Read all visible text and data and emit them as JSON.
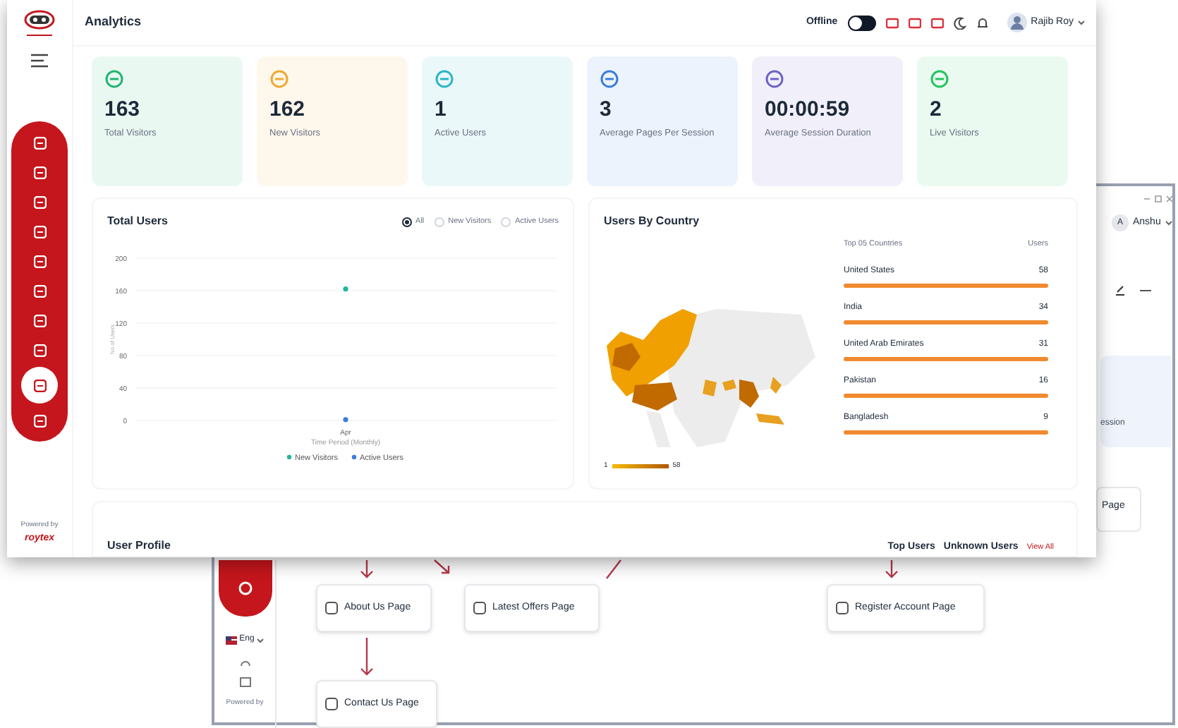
{
  "back_window": {
    "avatar_letter": "A",
    "user_name": "Anshu",
    "card_text": "ession",
    "node_partial": "Page",
    "sidebar": {
      "language": "Eng",
      "powered_by": "Powered by"
    },
    "flow_nodes": [
      {
        "label": "About Us Page"
      },
      {
        "label": "Latest Offers Page"
      },
      {
        "label": "Register Account Page"
      },
      {
        "label": "Contact Us Page"
      }
    ]
  },
  "front_window": {
    "sidebar": {
      "nav_items": [
        {
          "selected": false
        },
        {
          "selected": false
        },
        {
          "selected": false
        },
        {
          "selected": false
        },
        {
          "selected": false
        },
        {
          "selected": false
        },
        {
          "selected": false
        },
        {
          "selected": false
        },
        {
          "selected": true
        },
        {
          "selected": false
        }
      ],
      "powered_by": "Powered by",
      "brand": "roytex"
    },
    "header": {
      "title": "Analytics",
      "status_label": "Offline",
      "status_on": false,
      "user_name": "Rajib Roy"
    },
    "stats": [
      {
        "value": "163",
        "label": "Total Visitors",
        "color": "#22b573"
      },
      {
        "value": "162",
        "label": "New Visitors",
        "color": "#f0a830"
      },
      {
        "value": "1",
        "label": "Active Users",
        "color": "#2bb5c8"
      },
      {
        "value": "3",
        "label": "Average Pages Per Session",
        "color": "#3b7ddd"
      },
      {
        "value": "00:00:59",
        "label": "Average Session Duration",
        "color": "#6c63c9"
      },
      {
        "value": "2",
        "label": "Live Visitors",
        "color": "#22c55e"
      }
    ],
    "total_users": {
      "title": "Total Users",
      "filters": [
        {
          "label": "All",
          "selected": true
        },
        {
          "label": "New Visitors",
          "selected": false
        },
        {
          "label": "Active Users",
          "selected": false
        }
      ],
      "chart_data": {
        "type": "scatter",
        "grid": true,
        "legend": "bottom",
        "xlabel": "Time Period (Monthly)",
        "ylabel": "No of Users",
        "categories": [
          "Apr"
        ],
        "yticks": [
          200,
          160,
          120,
          80,
          40,
          0
        ],
        "ylim": [
          0,
          200
        ],
        "series": [
          {
            "name": "New Visitors",
            "color": "#22b5a0",
            "values": [
              162
            ]
          },
          {
            "name": "Active Users",
            "color": "#3b7ddd",
            "values": [
              1
            ]
          }
        ]
      }
    },
    "users_by_country": {
      "title": "Users By Country",
      "map_legend": {
        "min": "1",
        "max": "58"
      },
      "columns": [
        "Top 05 Countries",
        "Users"
      ],
      "rows": [
        {
          "country": "United States",
          "users": "58",
          "level": 1
        },
        {
          "country": "India",
          "users": "34",
          "level": 1
        },
        {
          "country": "United Arab Emirates",
          "users": "31",
          "level": 1
        },
        {
          "country": "Pakistan",
          "users": "16",
          "level": 1
        },
        {
          "country": "Bangladesh",
          "users": "9",
          "level": 1
        }
      ]
    },
    "user_profile": {
      "title": "User Profile",
      "tabs": [
        "Top Users",
        "Unknown Users"
      ],
      "view_all": "View All"
    }
  }
}
